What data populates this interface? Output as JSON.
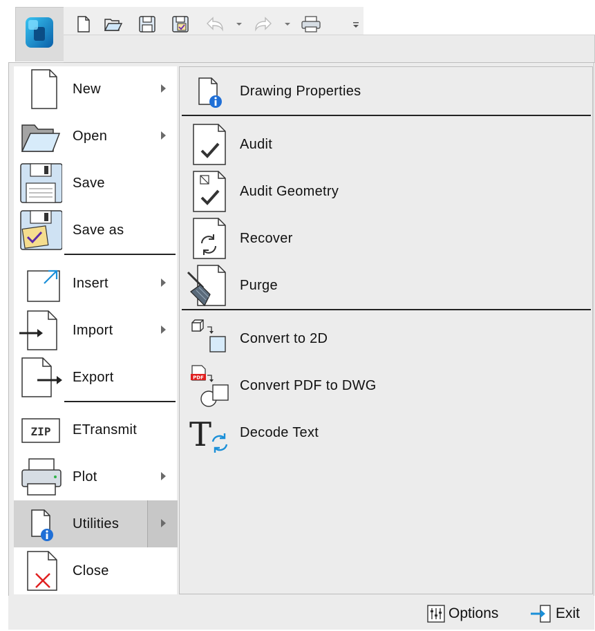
{
  "quick_access": {
    "icons": [
      "new-icon",
      "open-icon",
      "save-icon",
      "save-as-icon",
      "undo-icon",
      "redo-icon",
      "print-icon",
      "customize-icon"
    ]
  },
  "menu": {
    "items": [
      {
        "label": "New",
        "icon": "new-document-icon",
        "submenu": true
      },
      {
        "label": "Open",
        "icon": "folder-open-icon",
        "submenu": true
      },
      {
        "label": "Save",
        "icon": "floppy-icon",
        "submenu": false
      },
      {
        "label": "Save as",
        "icon": "save-as-icon",
        "submenu": false
      },
      {
        "label": "Insert",
        "icon": "insert-icon",
        "submenu": true
      },
      {
        "label": "Import",
        "icon": "import-icon",
        "submenu": true
      },
      {
        "label": "Export",
        "icon": "export-icon",
        "submenu": false
      },
      {
        "label": "ETransmit",
        "icon": "zip-icon",
        "submenu": false
      },
      {
        "label": "Plot",
        "icon": "printer-icon",
        "submenu": true
      },
      {
        "label": "Utilities",
        "icon": "utilities-icon",
        "submenu": true,
        "active": true
      },
      {
        "label": "Close",
        "icon": "close-document-icon",
        "submenu": false
      }
    ]
  },
  "utilities": {
    "items": [
      {
        "label": "Drawing Properties",
        "icon": "drawing-properties-icon"
      },
      {
        "label": "Audit",
        "icon": "audit-icon"
      },
      {
        "label": "Audit Geometry",
        "icon": "audit-geometry-icon"
      },
      {
        "label": "Recover",
        "icon": "recover-icon"
      },
      {
        "label": "Purge",
        "icon": "purge-broom-icon"
      },
      {
        "label": "Convert to 2D",
        "icon": "convert-2d-icon"
      },
      {
        "label": "Convert PDF to DWG",
        "icon": "pdf-to-dwg-icon"
      },
      {
        "label": "Decode Text",
        "icon": "decode-text-icon"
      }
    ]
  },
  "bottom": {
    "options_label": "Options",
    "exit_label": "Exit"
  },
  "colors": {
    "accent": "#1a8fd8",
    "highlight": "#d2d2d2",
    "error": "#e02020"
  }
}
